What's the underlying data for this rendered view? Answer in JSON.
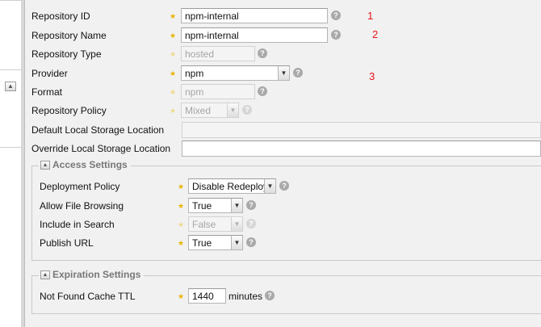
{
  "repository": {
    "fields": [
      {
        "label": "Repository ID",
        "value": "npm-internal"
      },
      {
        "label": "Repository Name",
        "value": "npm-internal"
      },
      {
        "label": "Repository Type",
        "value": "hosted"
      },
      {
        "label": "Provider",
        "value": "npm"
      },
      {
        "label": "Format",
        "value": "npm"
      },
      {
        "label": "Repository Policy",
        "value": "Mixed"
      },
      {
        "label": "Default Local Storage Location",
        "value": ""
      },
      {
        "label": "Override Local Storage Location",
        "value": ""
      }
    ]
  },
  "access_settings": {
    "title": "Access Settings",
    "fields": [
      {
        "label": "Deployment Policy",
        "value": "Disable Redeploy"
      },
      {
        "label": "Allow File Browsing",
        "value": "True"
      },
      {
        "label": "Include in Search",
        "value": "False"
      },
      {
        "label": "Publish URL",
        "value": "True"
      }
    ]
  },
  "expiration_settings": {
    "title": "Expiration Settings",
    "not_found_cache_ttl": {
      "label": "Not Found Cache TTL",
      "value": "1440",
      "unit": "minutes"
    }
  },
  "annotations": [
    "1",
    "2",
    "3"
  ],
  "icons": {
    "required": "star-icon",
    "help": "question-mark-icon",
    "collapse": "triangle-up-icon",
    "dropdown": "chevron-down-icon"
  },
  "colors": {
    "required_star": "#e9b200",
    "annotation": "#e8151b",
    "help_icon": "#a9a9a9",
    "legend_text": "#777777"
  }
}
